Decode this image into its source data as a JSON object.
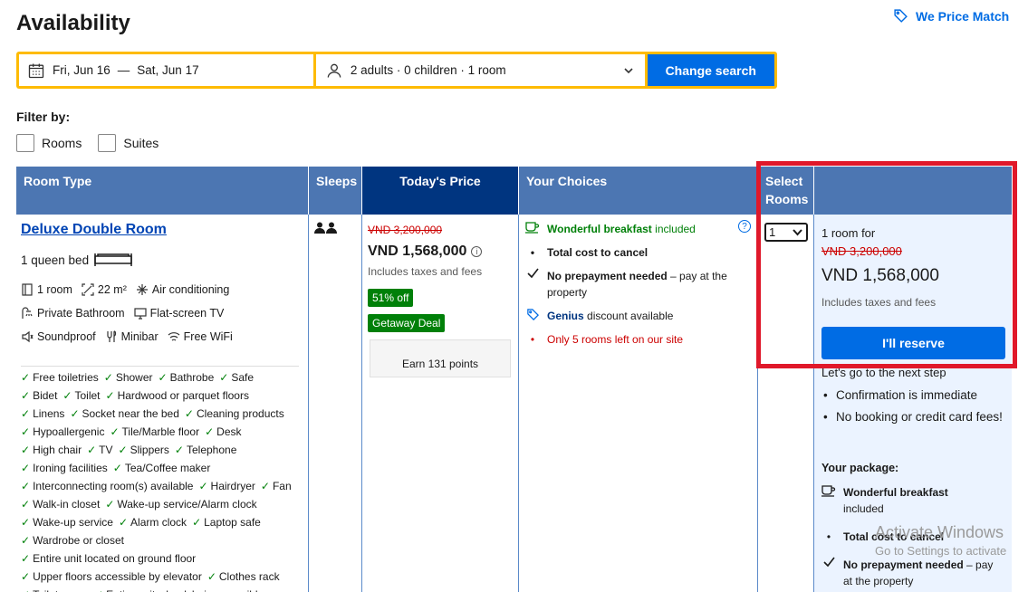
{
  "page": {
    "title": "Availability",
    "price_match": "We Price Match"
  },
  "search": {
    "check_in": "Fri, Jun 16",
    "dash": "—",
    "check_out": "Sat, Jun 17",
    "guests": "2 adults · 0 children · 1 room",
    "button": "Change search"
  },
  "filter": {
    "label": "Filter by:",
    "options": [
      "Rooms",
      "Suites"
    ]
  },
  "table": {
    "headers": {
      "room_type": "Room Type",
      "sleeps": "Sleeps",
      "todays_price": "Today's Price",
      "your_choices": "Your Choices",
      "select_rooms": "Select Rooms"
    }
  },
  "room": {
    "name": "Deluxe Double Room",
    "bed": "1 queen bed",
    "facilities_row1": [
      "1 room",
      "22 m²",
      "Air conditioning"
    ],
    "facilities_row2": [
      "Private Bathroom",
      "Flat-screen TV"
    ],
    "facilities_row3": [
      "Soundproof",
      "Minibar",
      "Free WiFi"
    ],
    "amenities": [
      [
        "Free toiletries",
        "Shower",
        "Bathrobe",
        "Safe"
      ],
      [
        "Bidet",
        "Toilet",
        "Hardwood or parquet floors"
      ],
      [
        "Linens",
        "Socket near the bed",
        "Cleaning products"
      ],
      [
        "Hypoallergenic",
        "Tile/Marble floor",
        "Desk"
      ],
      [
        "High chair",
        "TV",
        "Slippers",
        "Telephone"
      ],
      [
        "Ironing facilities",
        "Tea/Coffee maker"
      ],
      [
        "Interconnecting room(s) available",
        "Hairdryer",
        "Fan"
      ],
      [
        "Walk-in closet",
        "Wake-up service/Alarm clock"
      ],
      [
        "Wake-up service",
        "Alarm clock",
        "Laptop safe"
      ],
      [
        "Wardrobe or closet"
      ],
      [
        "Entire unit located on ground floor"
      ],
      [
        "Upper floors accessible by elevator",
        "Clothes rack"
      ],
      [
        "Toilet paper",
        "Entire unit wheelchair accessible"
      ]
    ]
  },
  "price": {
    "original": "VND 3,200,000",
    "current": "VND 1,568,000",
    "taxes": "Includes taxes and fees",
    "discount_badge": "51% off",
    "deal_badge": "Getaway Deal",
    "points": "Earn 131 points"
  },
  "choices": {
    "breakfast": "Wonderful breakfast",
    "breakfast_suffix": " included",
    "cancel": "Total cost to cancel",
    "prepay_bold": "No prepayment needed",
    "prepay_rest": " – pay at the property",
    "genius": "Genius",
    "genius_rest": " discount available",
    "scarcity": "Only 5 rooms left on our site",
    "help": "?"
  },
  "select": {
    "value": "1"
  },
  "reserve": {
    "rooms_for": "1 room for",
    "original": "VND 3,200,000",
    "current": "VND 1,568,000",
    "taxes": "Includes taxes and fees",
    "button": "I'll reserve",
    "next_step": "Let's go to the next step",
    "benefits": [
      "Confirmation is immediate",
      "No booking or credit card fees!"
    ],
    "package_title": "Your package:",
    "pkg_breakfast": "Wonderful breakfast",
    "pkg_breakfast_sub": "included",
    "pkg_cancel": "Total cost to cancel",
    "pkg_prepay_bold": "No prepayment needed",
    "pkg_prepay_rest": " – pay at the property"
  },
  "watermark": {
    "line1": "Activate Windows",
    "line2": "Go to Settings to activate"
  },
  "colors": {
    "accent": "#006ce4",
    "search_border": "#febb02",
    "header": "#4c76b2",
    "header_dark": "#003580",
    "highlight": "#e0182a",
    "green": "#008009"
  }
}
